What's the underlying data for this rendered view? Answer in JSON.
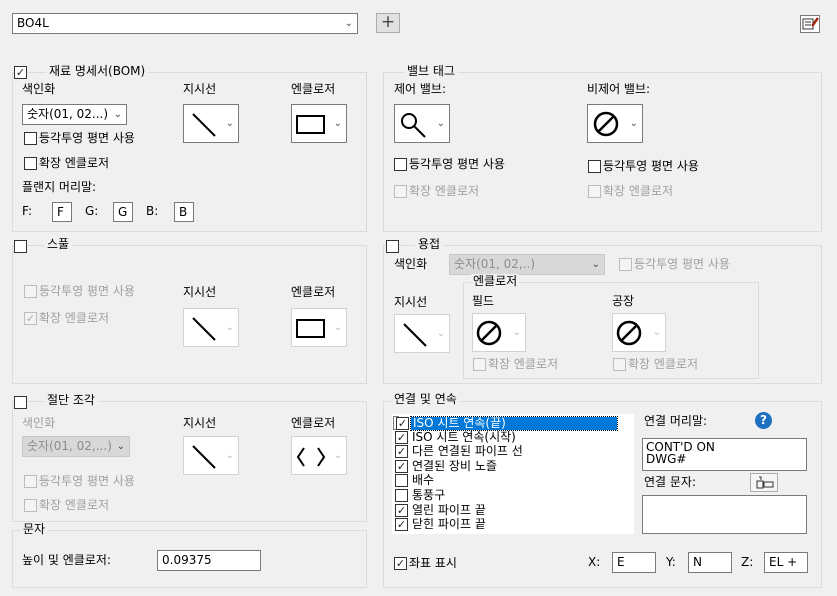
{
  "top": {
    "combo_value": "BO4L",
    "add_label": "+"
  },
  "bom": {
    "title": "재료 명세서(BOM)",
    "checked": true,
    "color_label": "색인화",
    "color_value": "숫자(01, 02...)",
    "iso_label": "등각투영 평면 사용",
    "ext_label": "확장 엔클로저",
    "leader_label": "지시선",
    "encl_label": "엔클로저",
    "flange_label": "플랜지 머리말:",
    "f_label": "F:",
    "f_value": "F",
    "g_label": "G:",
    "g_value": "G",
    "b_label": "B:",
    "b_value": "B"
  },
  "valve": {
    "title": "밸브 태그",
    "ctrl_label": "제어 밸브:",
    "nonctrl_label": "비제어 밸브:",
    "iso_label1": "등각투영 평면 사용",
    "ext_label1": "확장 엔클로저",
    "iso_label2": "등각투영 평면 사용",
    "ext_label2": "확장 엔클로저"
  },
  "spool": {
    "title": "스풀",
    "iso_label": "등각투영 평면 사용",
    "ext_label": "확장 엔클로저",
    "leader_label": "지시선",
    "encl_label": "엔클로저"
  },
  "weld": {
    "title": "용접",
    "color_label": "색인화",
    "color_value": "숫자(01, 02,..)",
    "iso_label": "등각투영 평면 사용",
    "encl_group": "엔클로저",
    "leader_label": "지시선",
    "field_label": "필드",
    "shop_label": "공장",
    "ext_label1": "확장 엔클로저",
    "ext_label2": "확장 엔클로저"
  },
  "cut": {
    "title": "절단 조각",
    "color_label": "색인화",
    "color_value": "숫자(01, 02,...)",
    "leader_label": "지시선",
    "encl_label": "엔클로저",
    "iso_label": "등각투영 평면 사용",
    "ext_label": "확장 엔클로저"
  },
  "text": {
    "title": "문자",
    "height_label": "높이 및 엔클로저:",
    "height_value": "0.09375"
  },
  "conn": {
    "title": "연결 및 연속",
    "items": [
      {
        "label": "ISO 시트 연속(끝)",
        "checked": true,
        "selected": true
      },
      {
        "label": "ISO 시트 연속(시작)",
        "checked": true,
        "selected": false
      },
      {
        "label": "다른 연결된 파이프 선",
        "checked": true,
        "selected": false
      },
      {
        "label": "연결된 장비 노즐",
        "checked": true,
        "selected": false
      },
      {
        "label": "배수",
        "checked": false,
        "selected": false
      },
      {
        "label": "통풍구",
        "checked": false,
        "selected": false
      },
      {
        "label": "열린 파이프 끝",
        "checked": true,
        "selected": false
      },
      {
        "label": "닫힌 파이프 끝",
        "checked": true,
        "selected": false
      }
    ],
    "header_label": "연결 머리말:",
    "header_value_line1": "CONT'D ON",
    "header_value_line2": "DWG#",
    "text_label": "연결 문자:",
    "coord_label": "좌표 표시",
    "x_label": "X:",
    "x_value": "E",
    "y_label": "Y:",
    "y_value": "N",
    "z_label": "Z:",
    "z_value": "EL +",
    "help": "?"
  }
}
